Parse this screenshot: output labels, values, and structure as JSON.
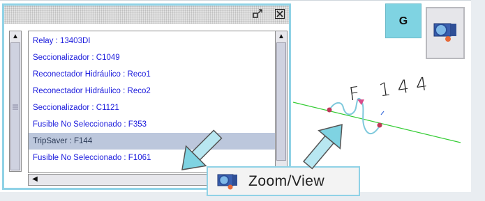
{
  "list": {
    "items": [
      {
        "label": "Relay : 13403DI",
        "selected": false
      },
      {
        "label": "Seccionalizador : C1049",
        "selected": false
      },
      {
        "label": "Reconectador Hidráulico : Reco1",
        "selected": false
      },
      {
        "label": "Reconectador Hidráulico : Reco2",
        "selected": false
      },
      {
        "label": "Seccionalizador : C1121",
        "selected": false
      },
      {
        "label": "Fusible No Seleccionado : F353",
        "selected": false
      },
      {
        "label": "TripSaver : F144",
        "selected": true
      },
      {
        "label": "Fusible No Seleccionado : F1061",
        "selected": false
      }
    ]
  },
  "toolbar": {
    "g_label": "G"
  },
  "tooltip": {
    "zoom_label": "Zoom/View"
  },
  "map": {
    "sketch_text": "F 144",
    "sketch_sub": "t"
  },
  "colors": {
    "accent": "#8fd2e6",
    "list_text": "#1a1adc",
    "selection": "#bcc7dc",
    "line": "#33cc33"
  }
}
